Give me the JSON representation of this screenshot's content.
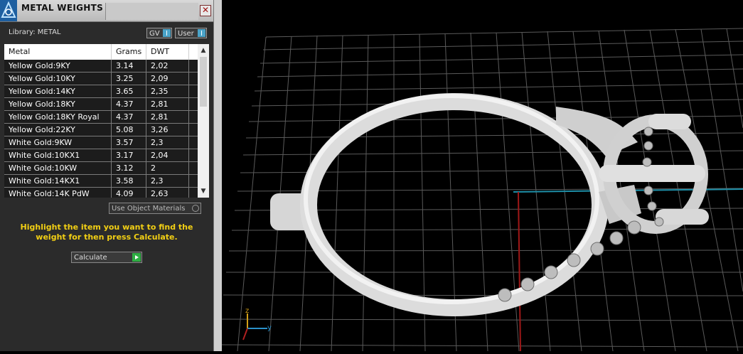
{
  "panel": {
    "title": "METAL WEIGHTS",
    "library_label": "Library: METAL",
    "toggles": [
      {
        "label": "GV"
      },
      {
        "label": "User"
      }
    ],
    "columns": [
      "Metal",
      "Grams",
      "DWT"
    ],
    "rows": [
      {
        "metal": "Yellow Gold:9KY",
        "grams": "3.14",
        "dwt": "2,02"
      },
      {
        "metal": "Yellow Gold:10KY",
        "grams": "3.25",
        "dwt": "2,09"
      },
      {
        "metal": "Yellow Gold:14KY",
        "grams": "3.65",
        "dwt": "2,35"
      },
      {
        "metal": "Yellow Gold:18KY",
        "grams": "4.37",
        "dwt": "2,81"
      },
      {
        "metal": "Yellow Gold:18KY Royal",
        "grams": "4.37",
        "dwt": "2,81"
      },
      {
        "metal": "Yellow Gold:22KY",
        "grams": "5.08",
        "dwt": "3,26"
      },
      {
        "metal": "White Gold:9KW",
        "grams": "3.57",
        "dwt": "2,3"
      },
      {
        "metal": "White Gold:10KX1",
        "grams": "3.17",
        "dwt": "2,04"
      },
      {
        "metal": "White Gold:10KW",
        "grams": "3.12",
        "dwt": "2"
      },
      {
        "metal": "White Gold:14KX1",
        "grams": "3.58",
        "dwt": "2,3"
      },
      {
        "metal": "White Gold:14K PdW",
        "grams": "4.09",
        "dwt": "2,63"
      }
    ],
    "use_object_materials": "Use Object Materials",
    "hint": "Highlight the item you want to find the weight for then press Calculate.",
    "calculate": "Calculate"
  },
  "viewport": {
    "axis_labels": {
      "z": "z",
      "y": "y"
    }
  }
}
